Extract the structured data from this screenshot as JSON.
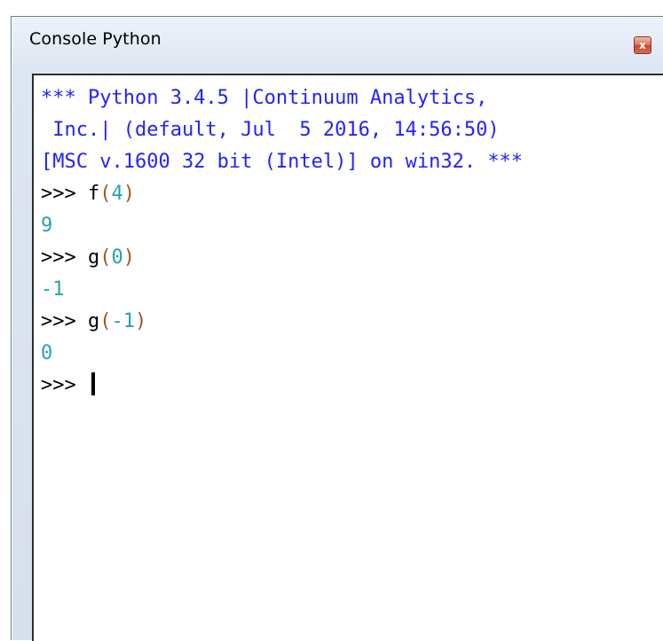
{
  "window": {
    "title": "Console Python",
    "close_icon_glyph": "x"
  },
  "console": {
    "banner": [
      "*** Python 3.4.5 |Continuum Analytics,",
      " Inc.| (default, Jul  5 2016, 14:56:50)",
      "[MSC v.1600 32 bit (Intel)] on win32. ***"
    ],
    "entries": [
      {
        "prompt": ">>> ",
        "fn": "f",
        "open": "(",
        "arg": "4",
        "close": ")",
        "output": "9"
      },
      {
        "prompt": ">>> ",
        "fn": "g",
        "open": "(",
        "arg": "0",
        "close": ")",
        "output": "-1"
      },
      {
        "prompt": ">>> ",
        "fn": "g",
        "open": "(",
        "arg": "-1",
        "close": ")",
        "output": "0"
      }
    ],
    "current_prompt": ">>> "
  },
  "colors": {
    "banner": "#2222ff",
    "output": "#2aa3a3",
    "paren": "#a0522d"
  }
}
